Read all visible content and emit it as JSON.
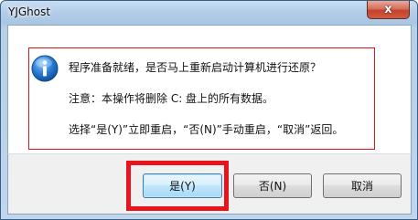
{
  "window": {
    "title": "YJGhost",
    "close_glyph": "x",
    "icon": "info-icon"
  },
  "message": {
    "line1": "程序准备就绪，是否马上重新启动计算机进行还原？",
    "line2": "注意：本操作将删除 C: 盘上的所有数据。",
    "line3": "选择“是(Y)”立即重启，“否(N)”手动重启，“取消”返回。"
  },
  "buttons": {
    "yes": "是(Y)",
    "no": "否(N)",
    "cancel": "取消"
  },
  "colors": {
    "highlight_box": "#e8141c",
    "message_border": "#d21a1a",
    "default_button": "#bee6fd"
  }
}
